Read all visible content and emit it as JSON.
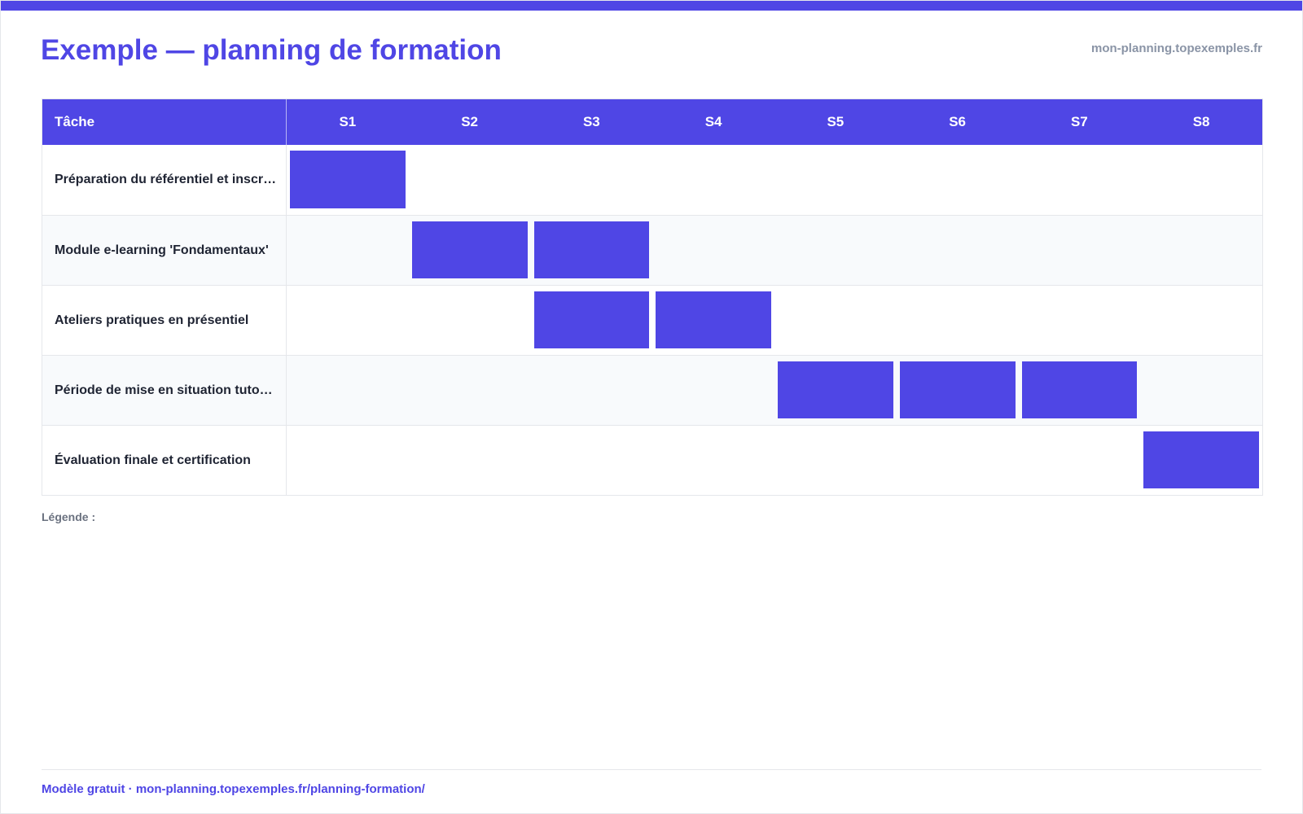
{
  "colors": {
    "accent": "#4f46e5",
    "header_text": "#ffffff",
    "muted": "#8a94a6",
    "row_alt": "#f8fafc"
  },
  "header": {
    "title": "Exemple — planning de formation",
    "site": "mon-planning.topexemples.fr"
  },
  "table": {
    "task_header": "Tâche",
    "weeks": [
      "S1",
      "S2",
      "S3",
      "S4",
      "S5",
      "S6",
      "S7",
      "S8"
    ],
    "tasks": [
      {
        "label": "Préparation du référentiel et inscr…",
        "active_weeks": [
          1
        ]
      },
      {
        "label": "Module e-learning 'Fondamentaux'",
        "active_weeks": [
          2,
          3
        ]
      },
      {
        "label": "Ateliers pratiques en présentiel",
        "active_weeks": [
          3,
          4
        ]
      },
      {
        "label": "Période de mise en situation tuto…",
        "active_weeks": [
          5,
          6,
          7
        ]
      },
      {
        "label": "Évaluation finale et certification",
        "active_weeks": [
          8
        ]
      }
    ]
  },
  "legend": {
    "label": "Légende :"
  },
  "footer": {
    "text": "Modèle gratuit · mon-planning.topexemples.fr/planning-formation/"
  }
}
